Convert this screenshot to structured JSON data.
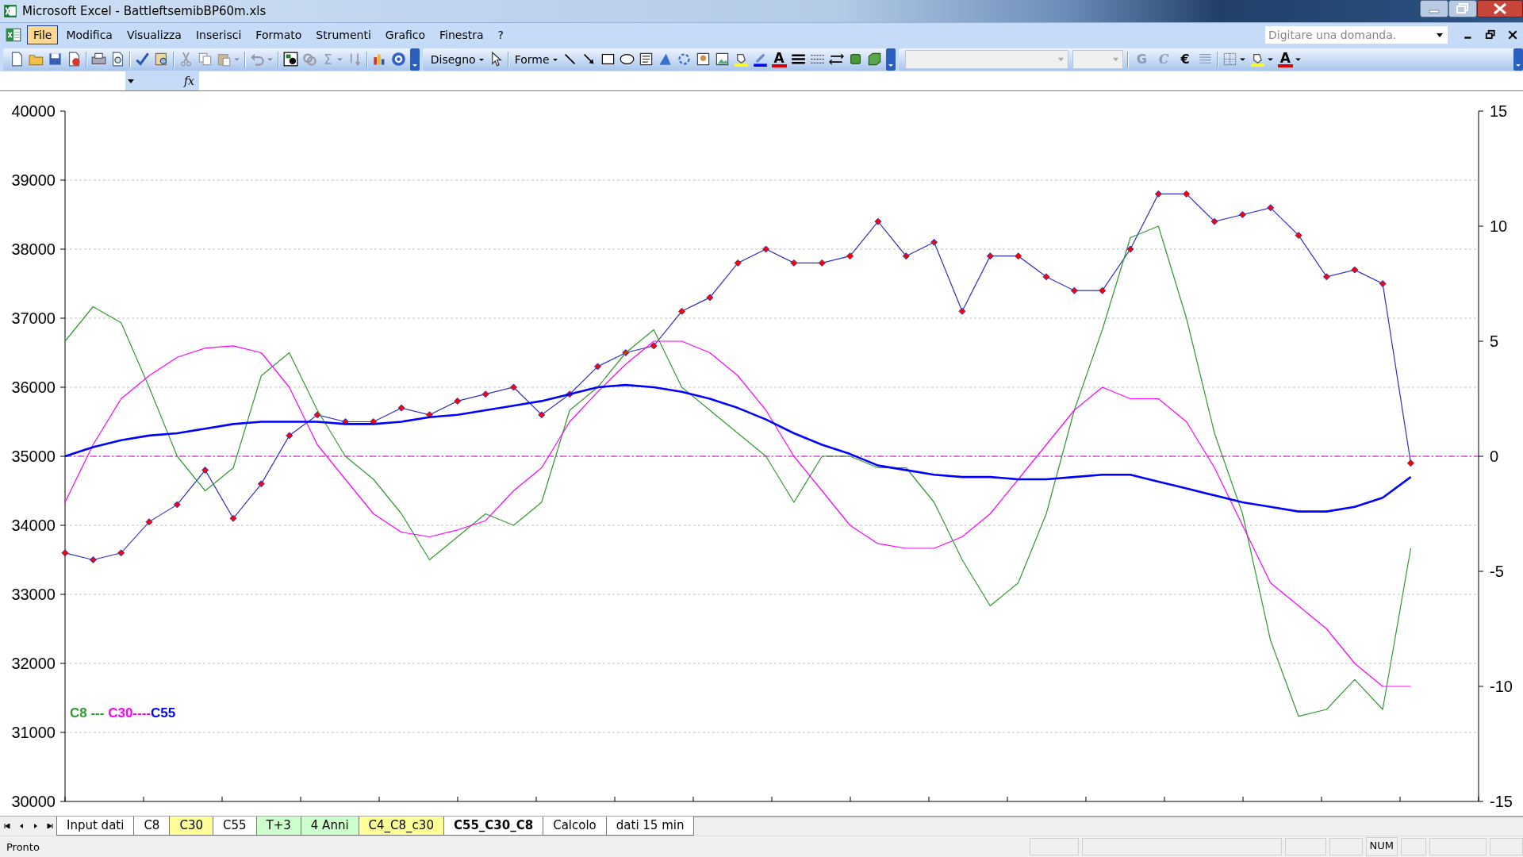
{
  "window": {
    "title": "Microsoft Excel - BattleftsemibBP60m.xls"
  },
  "menu": [
    {
      "label": "File",
      "selected": true
    },
    {
      "label": "Modifica",
      "selected": false
    },
    {
      "label": "Visualizza",
      "selected": false
    },
    {
      "label": "Inserisci",
      "selected": false
    },
    {
      "label": "Formato",
      "selected": false
    },
    {
      "label": "Strumenti",
      "selected": false
    },
    {
      "label": "Grafico",
      "selected": false
    },
    {
      "label": "Finestra",
      "selected": false
    },
    {
      "label": "?",
      "selected": false
    }
  ],
  "help_search": {
    "placeholder": "Digitare una domanda."
  },
  "toolbar": {
    "sum_button": "Σ",
    "drawing_menu": "Disegno",
    "shapes_menu": "Forme",
    "font_color_button": "A",
    "formatting": [
      {
        "kind": "bold",
        "label": "G",
        "disabled": true
      },
      {
        "kind": "italic",
        "label": "C",
        "disabled": true
      },
      {
        "kind": "currency",
        "label": "€",
        "disabled": false
      }
    ],
    "format_font_color_button": "A"
  },
  "formula_bar": {
    "function_label": "fx"
  },
  "chart": {
    "chart_data": {
      "type": "line",
      "categories": [
        null,
        null,
        null,
        null,
        null,
        null,
        null,
        null,
        null,
        null,
        null,
        null,
        null,
        null,
        null,
        null,
        null,
        null,
        null,
        null,
        null,
        null,
        null,
        null,
        null,
        null,
        null,
        null,
        null,
        null,
        null,
        null,
        null,
        null,
        null,
        null,
        null,
        null,
        null,
        null,
        null,
        null,
        null,
        null,
        null,
        null,
        null,
        null,
        null
      ],
      "grid": true,
      "ylim": [
        30000,
        40000
      ],
      "yticks": [
        30000,
        31000,
        32000,
        33000,
        34000,
        35000,
        36000,
        37000,
        38000,
        39000,
        40000
      ],
      "series": [
        {
          "color": "#3030c0",
          "marker": true,
          "values": [
            33600,
            33500,
            33600,
            34050,
            34300,
            34800,
            34100,
            34600,
            35300,
            35600,
            35500,
            35500,
            35700,
            35600,
            35800,
            35900,
            36000,
            35600,
            35900,
            36300,
            36500,
            36600,
            37100,
            37300,
            37800,
            38000,
            37800,
            37800,
            37900,
            38400,
            37900,
            38100,
            37100,
            37900,
            37900,
            37600,
            37400,
            37400,
            38000,
            38800,
            38800,
            38400,
            38500,
            38600,
            38200,
            37600,
            37700,
            37500,
            34900
          ]
        }
      ]
    }
  },
  "oscillator_chart": {
    "legend_separators": [
      " --- ",
      "----"
    ],
    "chart_data": {
      "type": "line",
      "categories": [
        null,
        null,
        null,
        null,
        null,
        null,
        null,
        null,
        null,
        null,
        null,
        null,
        null,
        null,
        null,
        null,
        null,
        null,
        null,
        null,
        null,
        null,
        null,
        null,
        null,
        null,
        null,
        null,
        null,
        null,
        null,
        null,
        null,
        null,
        null,
        null,
        null,
        null,
        null,
        null,
        null,
        null,
        null,
        null,
        null,
        null,
        null,
        null,
        null
      ],
      "ylim": [
        -15,
        15
      ],
      "ref_lines": [
        {
          "axis": "y",
          "value": 0,
          "color": "#cc00cc"
        }
      ],
      "yticks": [
        -15,
        -10,
        -5,
        0,
        5,
        10,
        15
      ],
      "series": [
        {
          "name": "C8",
          "color": "#339933",
          "values": [
            5,
            6.5,
            5.8,
            3,
            0,
            -1.5,
            -0.5,
            3.5,
            4.5,
            2,
            0,
            -1,
            -2.5,
            -4.5,
            -3.5,
            -2.5,
            -3,
            -2,
            2,
            3,
            4.5,
            5.5,
            3,
            2,
            1,
            0,
            -2,
            0,
            0,
            -0.5,
            -0.5,
            -2,
            -4.5,
            -6.5,
            -5.5,
            -2.5,
            2,
            5.5,
            9.5,
            10,
            6,
            1,
            -2.5,
            -8,
            -11.3,
            -11,
            -9.7,
            -11,
            -4
          ]
        },
        {
          "name": "C30",
          "color": "#ff00ff",
          "values": [
            -2,
            0.5,
            2.5,
            3.5,
            4.3,
            4.7,
            4.8,
            4.5,
            3,
            0.5,
            -1,
            -2.5,
            -3.3,
            -3.5,
            -3.2,
            -2.8,
            -1.5,
            -0.5,
            1.5,
            2.8,
            4,
            5,
            5,
            4.5,
            3.5,
            2,
            0,
            -1.5,
            -3,
            -3.8,
            -4,
            -4,
            -3.5,
            -2.5,
            -1,
            0.5,
            2,
            3,
            2.5,
            2.5,
            1.5,
            -0.5,
            -3,
            -5.5,
            -6.5,
            -7.5,
            -9,
            -10,
            -10
          ]
        },
        {
          "name": "C55",
          "color": "#0000ff",
          "values": [
            0,
            0.4,
            0.7,
            0.9,
            1,
            1.2,
            1.4,
            1.5,
            1.5,
            1.5,
            1.4,
            1.4,
            1.5,
            1.7,
            1.8,
            2,
            2.2,
            2.4,
            2.7,
            3,
            3.1,
            3,
            2.8,
            2.5,
            2.1,
            1.6,
            1,
            0.5,
            0.1,
            -0.4,
            -0.6,
            -0.8,
            -0.9,
            -0.9,
            -1,
            -1,
            -0.9,
            -0.8,
            -0.8,
            -1.1,
            -1.4,
            -1.7,
            -2,
            -2.2,
            -2.4,
            -2.4,
            -2.2,
            -1.8,
            -0.9
          ]
        }
      ]
    }
  },
  "sheet_tabs": [
    {
      "label": "Input dati",
      "selected": false,
      "color": "#ffffff"
    },
    {
      "label": "C8",
      "selected": false,
      "color": "#ffffff"
    },
    {
      "label": "C30",
      "selected": false,
      "color": "#ffff99"
    },
    {
      "label": "C55",
      "selected": false,
      "color": "#ffffff"
    },
    {
      "label": "T+3",
      "selected": false,
      "color": "#ccffcc"
    },
    {
      "label": "4 Anni",
      "selected": false,
      "color": "#ccffcc"
    },
    {
      "label": "C4_C8_c30",
      "selected": false,
      "color": "#ffff99"
    },
    {
      "label": "C55_C30_C8",
      "selected": true,
      "color": "#ffffff"
    },
    {
      "label": "Calcolo",
      "selected": false,
      "color": "#ffffff"
    },
    {
      "label": "dati 15 min",
      "selected": false,
      "color": "#ffffff"
    }
  ],
  "status_bar": {
    "message": "Pronto",
    "indicators": [
      "NUM"
    ]
  }
}
